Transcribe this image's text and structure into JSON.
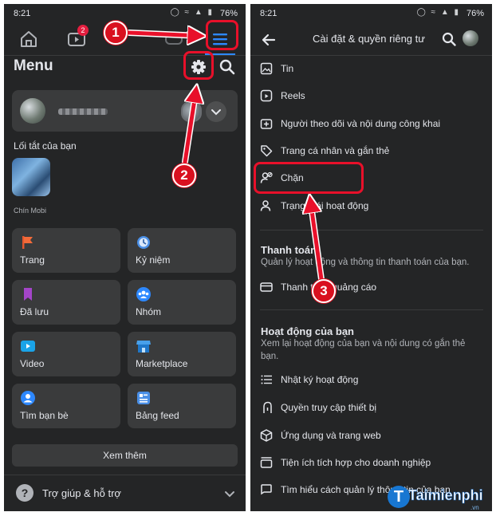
{
  "status": {
    "time": "8:21",
    "battery": "76%",
    "icons": "◯ ≈ ▲ ▮"
  },
  "left": {
    "tabs": {
      "home_icon": "home-icon",
      "video_badge": "2",
      "menu_icon": "hamburger-icon"
    },
    "menu_title": "Menu",
    "shortcuts_label": "Lối tắt của bạn",
    "shortcut_name": "Chín Mobi",
    "grid": [
      {
        "label": "Trang",
        "icon": "flag-icon"
      },
      {
        "label": "Kỷ niệm",
        "icon": "clock-icon"
      },
      {
        "label": "Đã lưu",
        "icon": "bookmark-icon"
      },
      {
        "label": "Nhóm",
        "icon": "groups-icon"
      },
      {
        "label": "Video",
        "icon": "video-icon"
      },
      {
        "label": "Marketplace",
        "icon": "shop-icon"
      },
      {
        "label": "Tìm bạn bè",
        "icon": "find-friends-icon"
      },
      {
        "label": "Bảng feed",
        "icon": "feed-icon"
      }
    ],
    "see_more": "Xem thêm",
    "help": "Trợ giúp & hỗ trợ"
  },
  "right": {
    "title": "Cài đặt & quyền riêng tư",
    "rows_top": [
      {
        "label": "Tin",
        "icon": "story-icon"
      },
      {
        "label": "Reels",
        "icon": "reels-icon"
      },
      {
        "label": "Người theo dõi và nội dung công khai",
        "icon": "followers-icon"
      },
      {
        "label": "Trang cá nhân và gắn thẻ",
        "icon": "tag-icon"
      },
      {
        "label": "Chặn",
        "icon": "block-user-icon"
      },
      {
        "label": "Trạng thái hoạt động",
        "icon": "active-status-icon"
      }
    ],
    "payments": {
      "title": "Thanh toán",
      "desc": "Quản lý hoạt động và thông tin thanh toán của bạn.",
      "row": "Thanh toán quảng cáo"
    },
    "activity": {
      "title": "Hoạt động của bạn",
      "desc": "Xem lại hoạt động của bạn và nội dung có gắn thẻ bạn.",
      "rows": [
        {
          "label": "Nhật ký hoạt động",
          "icon": "list-icon"
        },
        {
          "label": "Quyền truy cập thiết bị",
          "icon": "device-icon"
        },
        {
          "label": "Ứng dụng và trang web",
          "icon": "apps-icon"
        },
        {
          "label": "Tiện ích tích hợp cho doanh nghiệp",
          "icon": "business-icon"
        },
        {
          "label": "Tìm hiểu cách quản lý thông tin của bạn",
          "icon": "info-icon"
        }
      ]
    }
  },
  "annotations": [
    "1",
    "2",
    "3"
  ],
  "colors": {
    "bg": "#242526",
    "card": "#3a3b3c",
    "accent": "#2d88ff",
    "annotation": "#e8102a"
  },
  "watermark": {
    "brand": "Taimienphi",
    "suffix": ".vn"
  }
}
